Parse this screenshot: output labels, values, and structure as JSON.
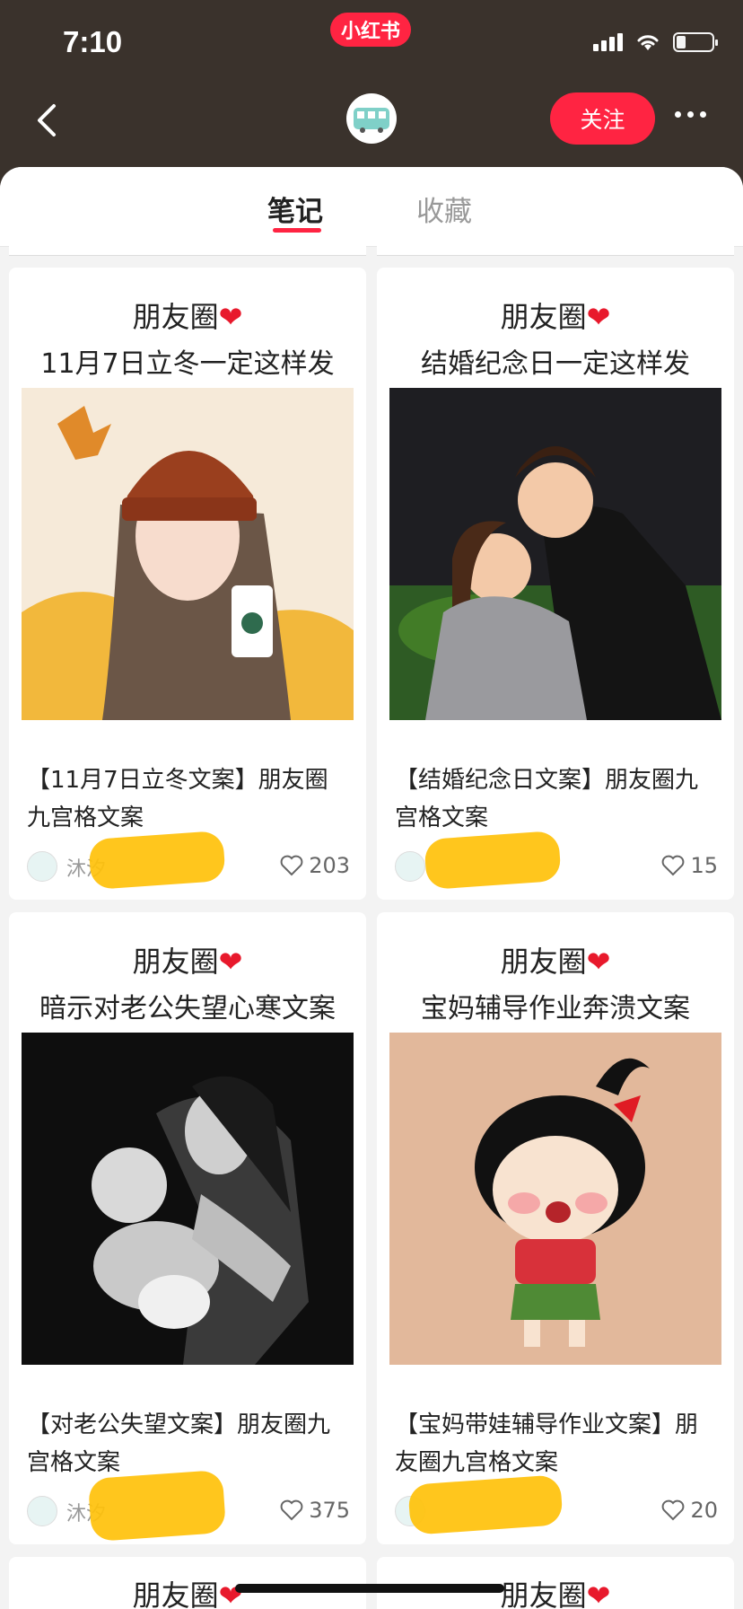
{
  "status_bar": {
    "time": "7:10",
    "app_badge": "小红书"
  },
  "nav": {
    "follow_label": "关注"
  },
  "tabs": [
    {
      "label": "笔记"
    },
    {
      "label": "收藏"
    }
  ],
  "cards": [
    {
      "caption_line1": "朋友圈",
      "caption_line2": "11月7日立冬一定这样发",
      "title": "【11月7日立冬文案】朋友圈九宫格文案",
      "author": "沐汐",
      "likes": "203"
    },
    {
      "caption_line1": "朋友圈",
      "caption_line2": "结婚纪念日一定这样发",
      "title": "【结婚纪念日文案】朋友圈九宫格文案",
      "author": "",
      "likes": "15"
    },
    {
      "caption_line1": "朋友圈",
      "caption_line2": "暗示对老公失望心寒文案",
      "title": "【对老公失望文案】朋友圈九宫格文案",
      "author": "沐汐",
      "likes": "375"
    },
    {
      "caption_line1": "朋友圈",
      "caption_line2": "宝妈辅导作业奔溃文案",
      "title": "【宝妈带娃辅导作业文案】朋友圈九宫格文案",
      "author": "",
      "likes": "20"
    }
  ],
  "partial_cards": [
    {
      "caption_line1": "朋友圈"
    },
    {
      "caption_line1": "朋友圈"
    }
  ],
  "colors": {
    "brand": "#ff2442",
    "header_bg": "#3a322c"
  }
}
